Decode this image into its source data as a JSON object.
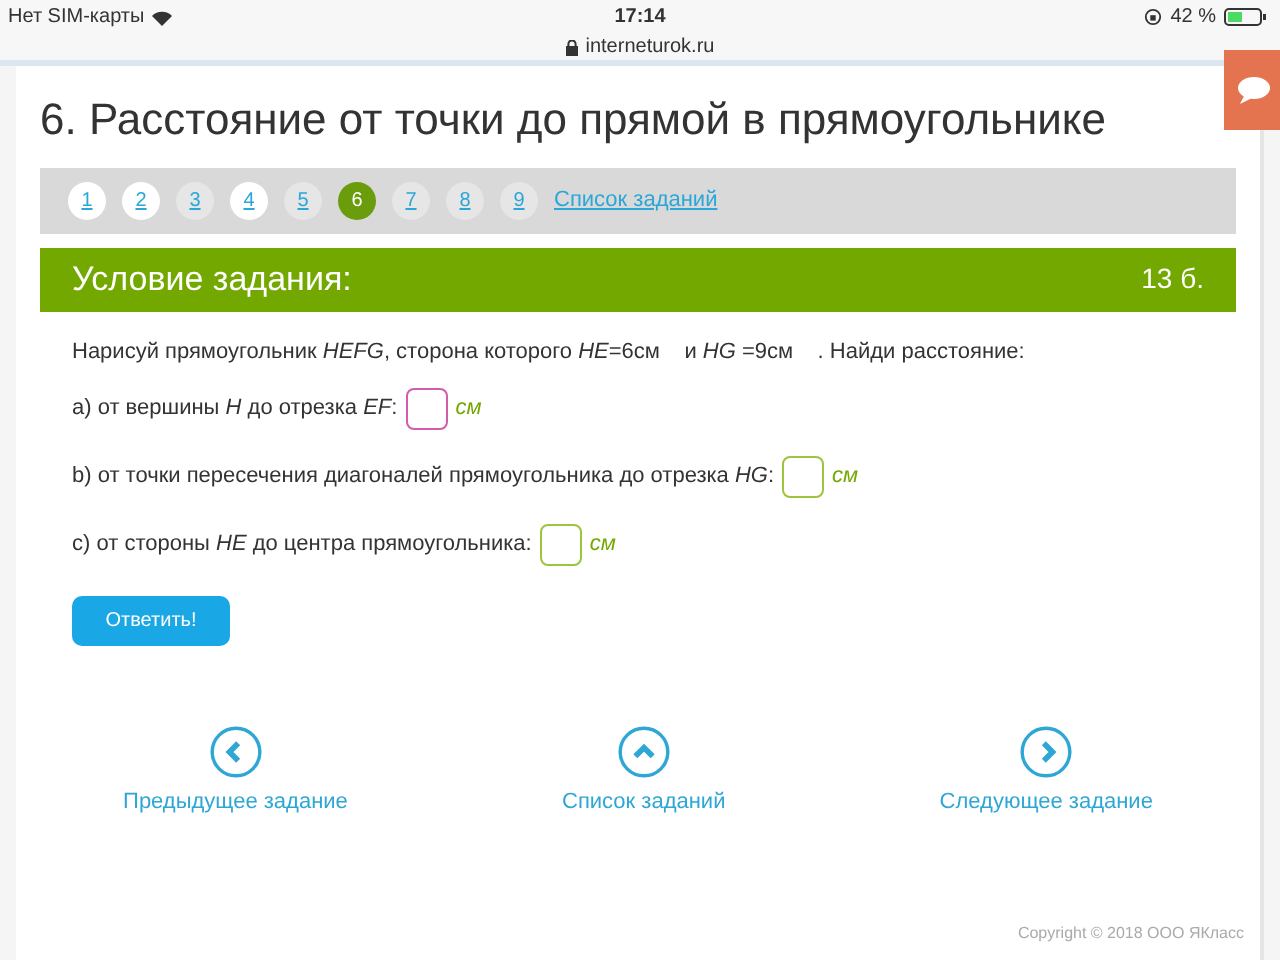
{
  "status_bar": {
    "carrier": "Нет SIM-карты",
    "time": "17:14",
    "url": "interneturok.ru",
    "battery": "42 %"
  },
  "title": "6. Расстояние от точки до прямой в прямоугольнике",
  "pager": [
    {
      "label": "1",
      "visited": true,
      "selected": false
    },
    {
      "label": "2",
      "visited": true,
      "selected": false
    },
    {
      "label": "3",
      "visited": false,
      "selected": false
    },
    {
      "label": "4",
      "visited": true,
      "selected": false
    },
    {
      "label": "5",
      "visited": false,
      "selected": false
    },
    {
      "label": "6",
      "visited": false,
      "selected": true
    },
    {
      "label": "7",
      "visited": false,
      "selected": false
    },
    {
      "label": "8",
      "visited": false,
      "selected": false
    },
    {
      "label": "9",
      "visited": false,
      "selected": false
    }
  ],
  "task_list_link": "Список заданий",
  "task": {
    "heading": "Условие задания:",
    "points": "13 б.",
    "statement": "Нарисуй прямоугольник *HEFG*, сторона которого *HE*=6см    и *HG* =9см    . Найди расстояние:",
    "questions": [
      {
        "text": "a) от вершины *H* до отрезка *EF*:",
        "focused": true,
        "unit": "см"
      },
      {
        "text": "b) от точки пересечения диагоналей прямоугольника до отрезка *HG*:",
        "focused": false,
        "unit": "см"
      },
      {
        "text": "c) от стороны *HE* до центра прямоугольника:",
        "focused": false,
        "unit": "см"
      }
    ],
    "submit": "Ответить!"
  },
  "nav": [
    {
      "kind": "prev",
      "label": "Предыдущее задание"
    },
    {
      "kind": "up",
      "label": "Список заданий"
    },
    {
      "kind": "next",
      "label": "Следующее задание"
    }
  ],
  "copyright": "Copyright © 2018 ООО ЯКласс"
}
